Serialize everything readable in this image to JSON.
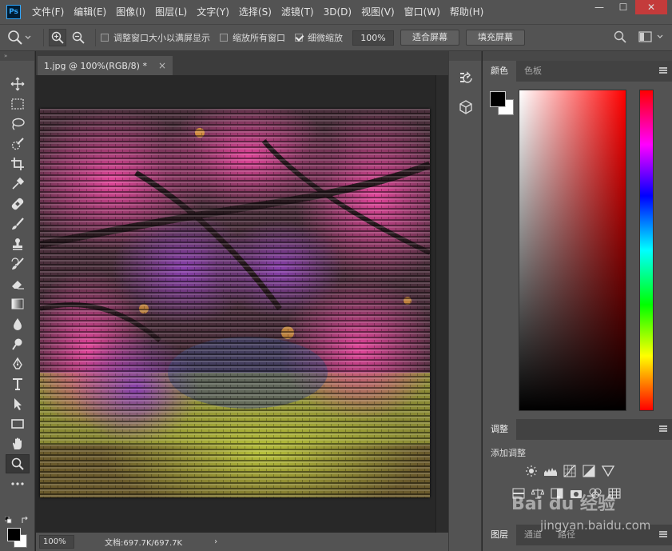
{
  "app": {
    "logo": "Ps"
  },
  "menu": [
    "文件(F)",
    "编辑(E)",
    "图像(I)",
    "图层(L)",
    "文字(Y)",
    "选择(S)",
    "滤镜(T)",
    "3D(D)",
    "视图(V)",
    "窗口(W)",
    "帮助(H)"
  ],
  "window_controls": {
    "minimize": "—",
    "maximize": "☐",
    "close": "✕"
  },
  "options": {
    "resize_windows_label": "调整窗口大小以满屏显示",
    "zoom_all_label": "缩放所有窗口",
    "scrubby_label": "细微缩放",
    "zoom_value": "100%",
    "fit_screen": "适合屏幕",
    "fill_screen": "填充屏幕"
  },
  "document": {
    "tab_title": "1.jpg @ 100%(RGB/8) *",
    "close": "×"
  },
  "status": {
    "zoom": "100%",
    "doc_info": "文档:697.7K/697.7K",
    "arrow": "›"
  },
  "panels": {
    "color_tab": "颜色",
    "swatches_tab": "色板",
    "adjustments_tab": "调整",
    "add_adjustment": "添加调整",
    "layers_tab": "图层",
    "channels_tab": "通道",
    "paths_tab": "路径"
  },
  "watermark": {
    "brand": "Bai du 经验",
    "url": "jingyan.baidu.com"
  },
  "colors": {
    "foreground": "#000000",
    "background": "#ffffff",
    "accent": "#31a8ff"
  }
}
